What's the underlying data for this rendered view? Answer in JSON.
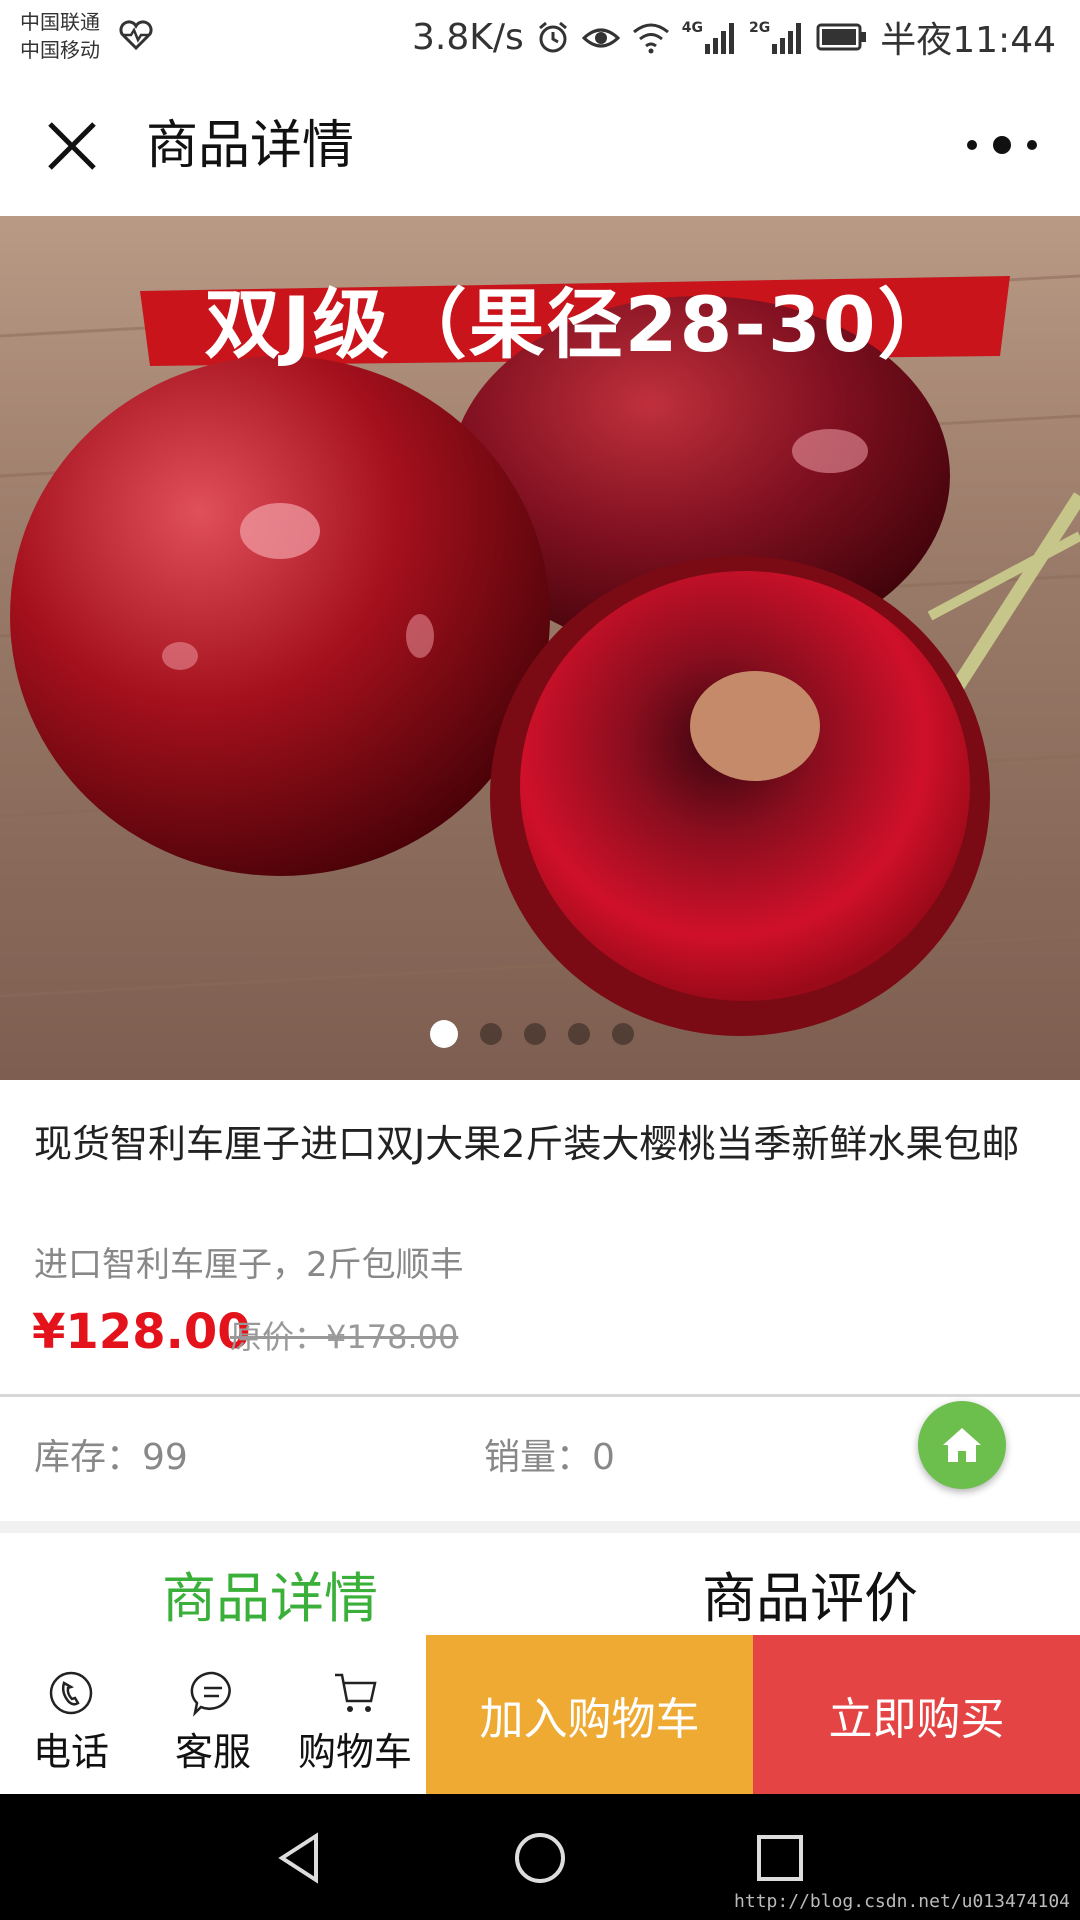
{
  "status_bar": {
    "carrier_1": "中国联通",
    "carrier_2": "中国移动",
    "net_speed": "3.8K/s",
    "network_1": "4G",
    "network_2": "2G",
    "time": "半夜11:44"
  },
  "nav": {
    "title": "商品详情"
  },
  "banner": {
    "label": "双J级（果径28-30）",
    "slide_count": 5,
    "active_slide": 1
  },
  "product": {
    "title": "现货智利车厘子进口双J大果2斤装大樱桃当季新鲜水果包邮",
    "subtitle": "进口智利车厘子，2斤包顺丰",
    "price": "¥128.00",
    "original_price": "原价：¥178.00",
    "stock": "库存：99",
    "sales": "销量：0"
  },
  "tabs": [
    {
      "label": "商品详情",
      "active": true
    },
    {
      "label": "商品评价",
      "active": false
    }
  ],
  "action_bar": {
    "phone_label": "电话",
    "service_label": "客服",
    "cart_label": "购物车",
    "add_to_cart_label": "加入购物车",
    "buy_now_label": "立即购买"
  },
  "watermark": "http://blog.csdn.net/u013474104",
  "colors": {
    "price": "#e3121b",
    "active_tab": "#3ab03a",
    "home_button": "#6cbe4d",
    "add_to_cart": "#eeaa33",
    "buy_now": "#e54444"
  }
}
